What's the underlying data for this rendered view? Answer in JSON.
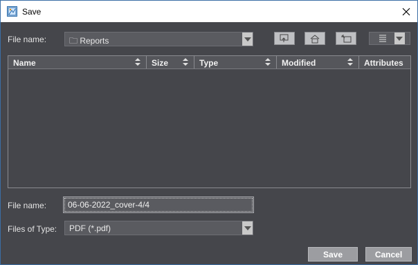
{
  "window": {
    "title": "Save",
    "app_icon": "save-dialog-app-icon",
    "close_icon": "close-icon"
  },
  "look_in": {
    "label": "File name:",
    "value": "🗀 Reports"
  },
  "toolbar": {
    "buttons": [
      {
        "icon": "up-folder-icon"
      },
      {
        "icon": "home-icon"
      },
      {
        "icon": "new-folder-icon"
      },
      {
        "icon": "view-menu-icon"
      }
    ]
  },
  "table": {
    "columns": [
      "Name",
      "Size",
      "Type",
      "Modified",
      "Attributes"
    ],
    "rows": []
  },
  "file_name": {
    "label": "File name:",
    "value": "06-06-2022_cover-4/4"
  },
  "file_type": {
    "label": "Files of Type:",
    "value": "PDF (*.pdf)"
  },
  "actions": {
    "save_label": "Save",
    "cancel_label": "Cancel"
  },
  "colors": {
    "background": "#45464b",
    "field": "#5a5b60",
    "button": "#9c9da1",
    "titlebar": "#ffffff"
  }
}
